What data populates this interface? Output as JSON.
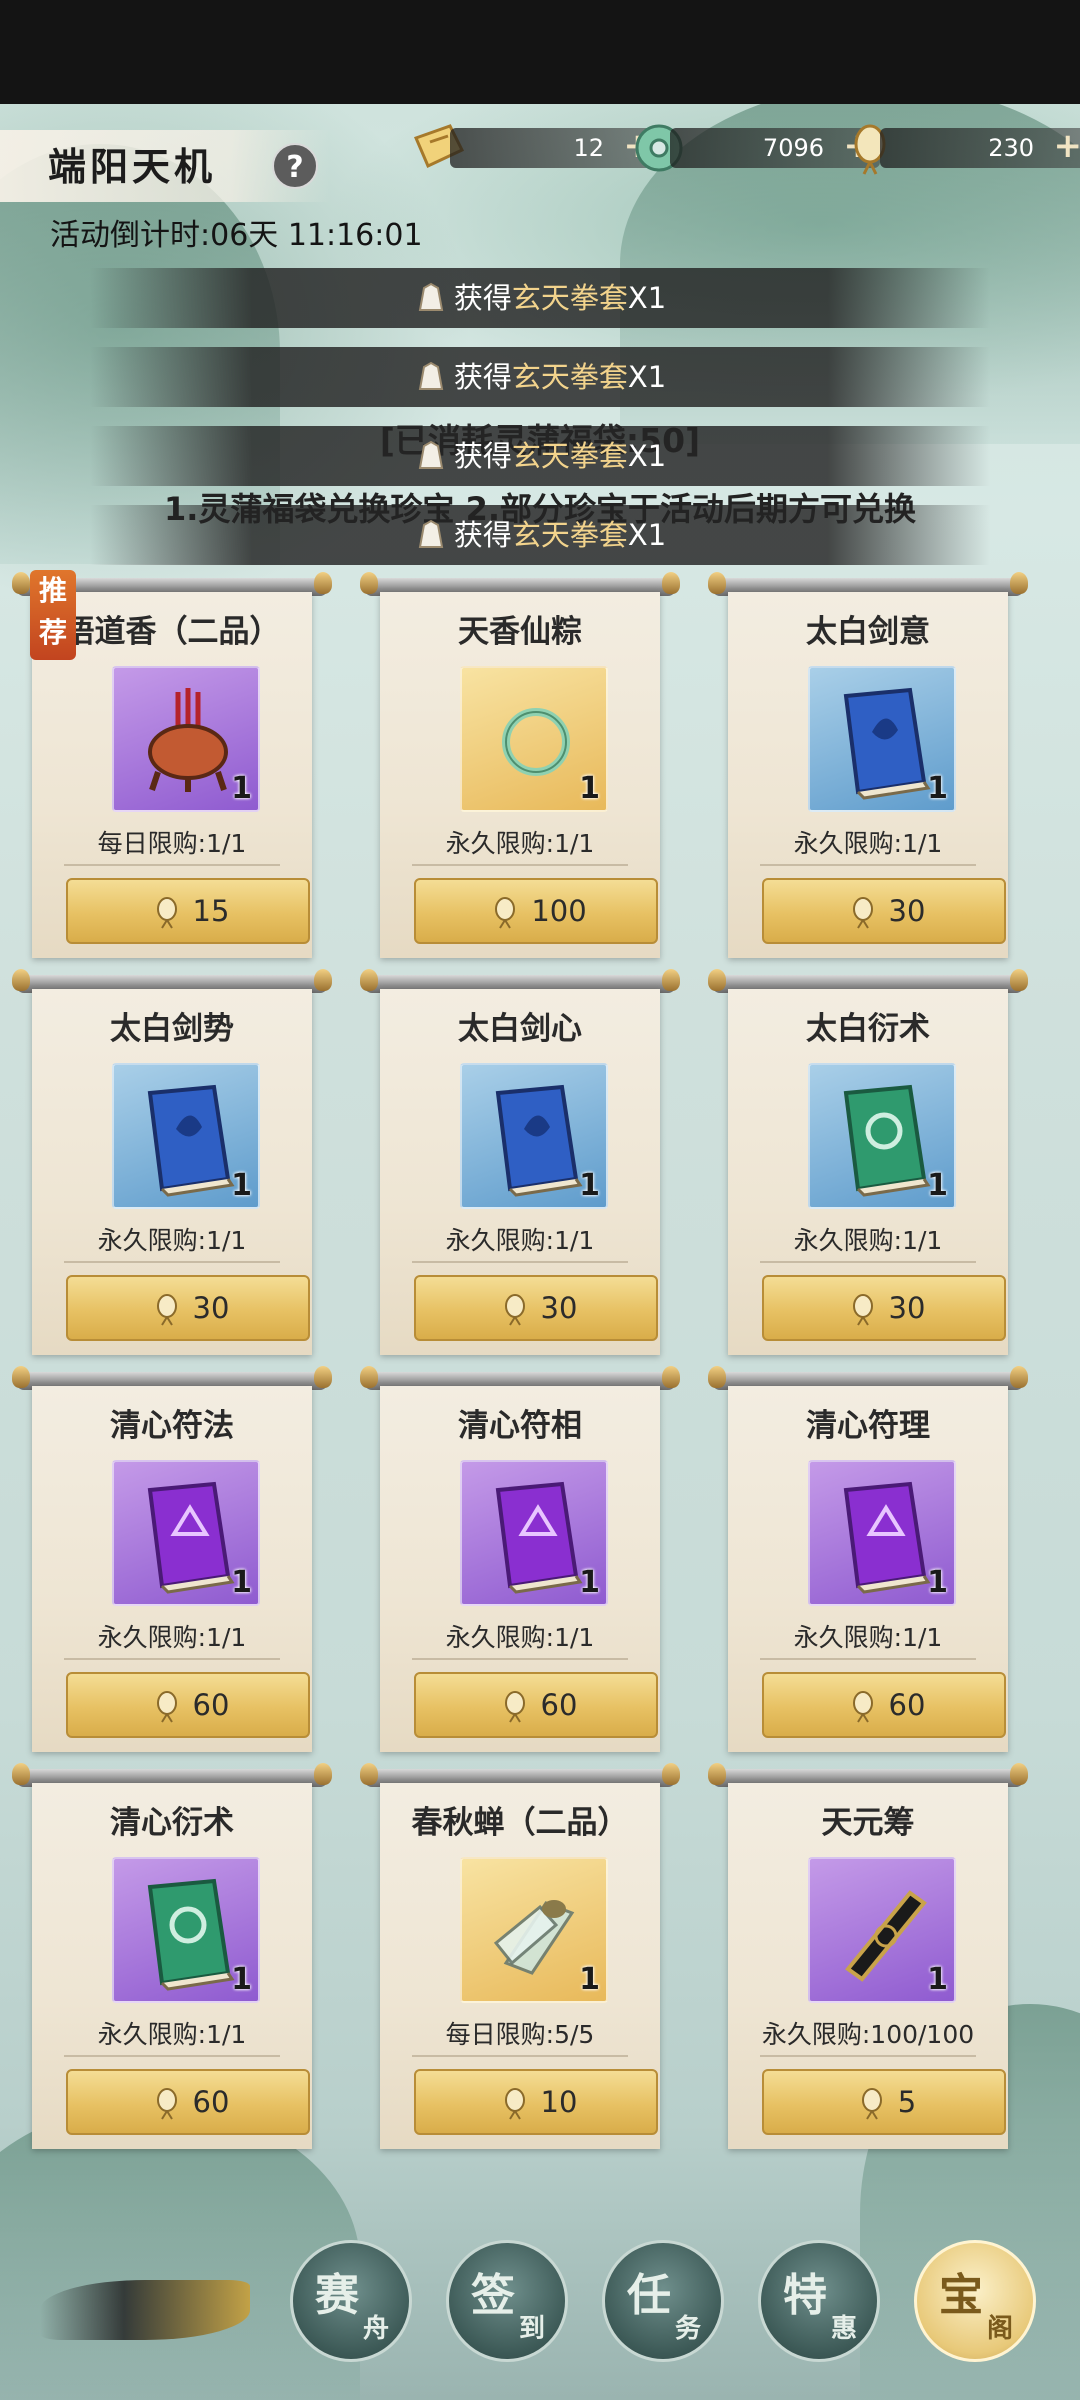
{
  "header": {
    "title": "端阳天机",
    "help": "?",
    "countdown_label": "活动倒计时:",
    "countdown_value": "06天 11:16:01"
  },
  "resources": [
    {
      "icon": "ticket-icon",
      "value": "12",
      "plus": "+"
    },
    {
      "icon": "jade-coin-icon",
      "value": "7096",
      "plus": "+"
    },
    {
      "icon": "lucky-bag-icon",
      "value": "230",
      "plus": "+"
    }
  ],
  "toasts": [
    {
      "prefix": "获得",
      "item": "玄天拳套",
      "suffix": "X1"
    },
    {
      "prefix": "获得",
      "item": "玄天拳套",
      "suffix": "X1"
    },
    {
      "prefix": "获得",
      "item": "玄天拳套",
      "suffix": "X1"
    },
    {
      "prefix": "获得",
      "item": "玄天拳套",
      "suffix": "X1"
    }
  ],
  "consumed_text": "[已消耗灵蒲福袋:50]",
  "notice_text": "1.灵蒲福袋兑换珍宝 2.部分珍宝于活动后期方可兑换",
  "badge_text": "推荐",
  "shop_items": [
    {
      "name": "悟道香（二品）",
      "qty": "1",
      "limit": "每日限购:1/1",
      "price": "15",
      "bg": "purple",
      "icon": "incense-burner-icon"
    },
    {
      "name": "天香仙粽",
      "qty": "1",
      "limit": "永久限购:1/1",
      "price": "100",
      "bg": "gold",
      "icon": "jade-ring-icon"
    },
    {
      "name": "太白剑意",
      "qty": "1",
      "limit": "永久限购:1/1",
      "price": "30",
      "bg": "blue",
      "icon": "blue-book-icon"
    },
    {
      "name": "太白剑势",
      "qty": "1",
      "limit": "永久限购:1/1",
      "price": "30",
      "bg": "blue",
      "icon": "blue-book-icon"
    },
    {
      "name": "太白剑心",
      "qty": "1",
      "limit": "永久限购:1/1",
      "price": "30",
      "bg": "blue",
      "icon": "blue-book-icon"
    },
    {
      "name": "太白衍术",
      "qty": "1",
      "limit": "永久限购:1/1",
      "price": "30",
      "bg": "blue",
      "icon": "green-book-icon"
    },
    {
      "name": "清心符法",
      "qty": "1",
      "limit": "永久限购:1/1",
      "price": "60",
      "bg": "purple",
      "icon": "purple-book-icon"
    },
    {
      "name": "清心符相",
      "qty": "1",
      "limit": "永久限购:1/1",
      "price": "60",
      "bg": "purple",
      "icon": "purple-book-icon"
    },
    {
      "name": "清心符理",
      "qty": "1",
      "limit": "永久限购:1/1",
      "price": "60",
      "bg": "purple",
      "icon": "purple-book-icon"
    },
    {
      "name": "清心衍术",
      "qty": "1",
      "limit": "永久限购:1/1",
      "price": "60",
      "bg": "purple",
      "icon": "green-book-icon"
    },
    {
      "name": "春秋蝉（二品）",
      "qty": "1",
      "limit": "每日限购:5/5",
      "price": "10",
      "bg": "gold",
      "icon": "cicada-icon"
    },
    {
      "name": "天元筹",
      "qty": "1",
      "limit": "永久限购:100/100",
      "price": "5",
      "bg": "purple",
      "icon": "token-tablet-icon"
    }
  ],
  "nav": [
    {
      "big": "赛",
      "small": "舟",
      "active": false
    },
    {
      "big": "签",
      "small": "到",
      "active": false
    },
    {
      "big": "任",
      "small": "务",
      "active": false
    },
    {
      "big": "特",
      "small": "惠",
      "active": false
    },
    {
      "big": "宝",
      "small": "阁",
      "active": true
    }
  ],
  "colors": {
    "toast_item": "#f2d38c",
    "buy_button": "#e7c163",
    "badge": "#d2562a"
  }
}
